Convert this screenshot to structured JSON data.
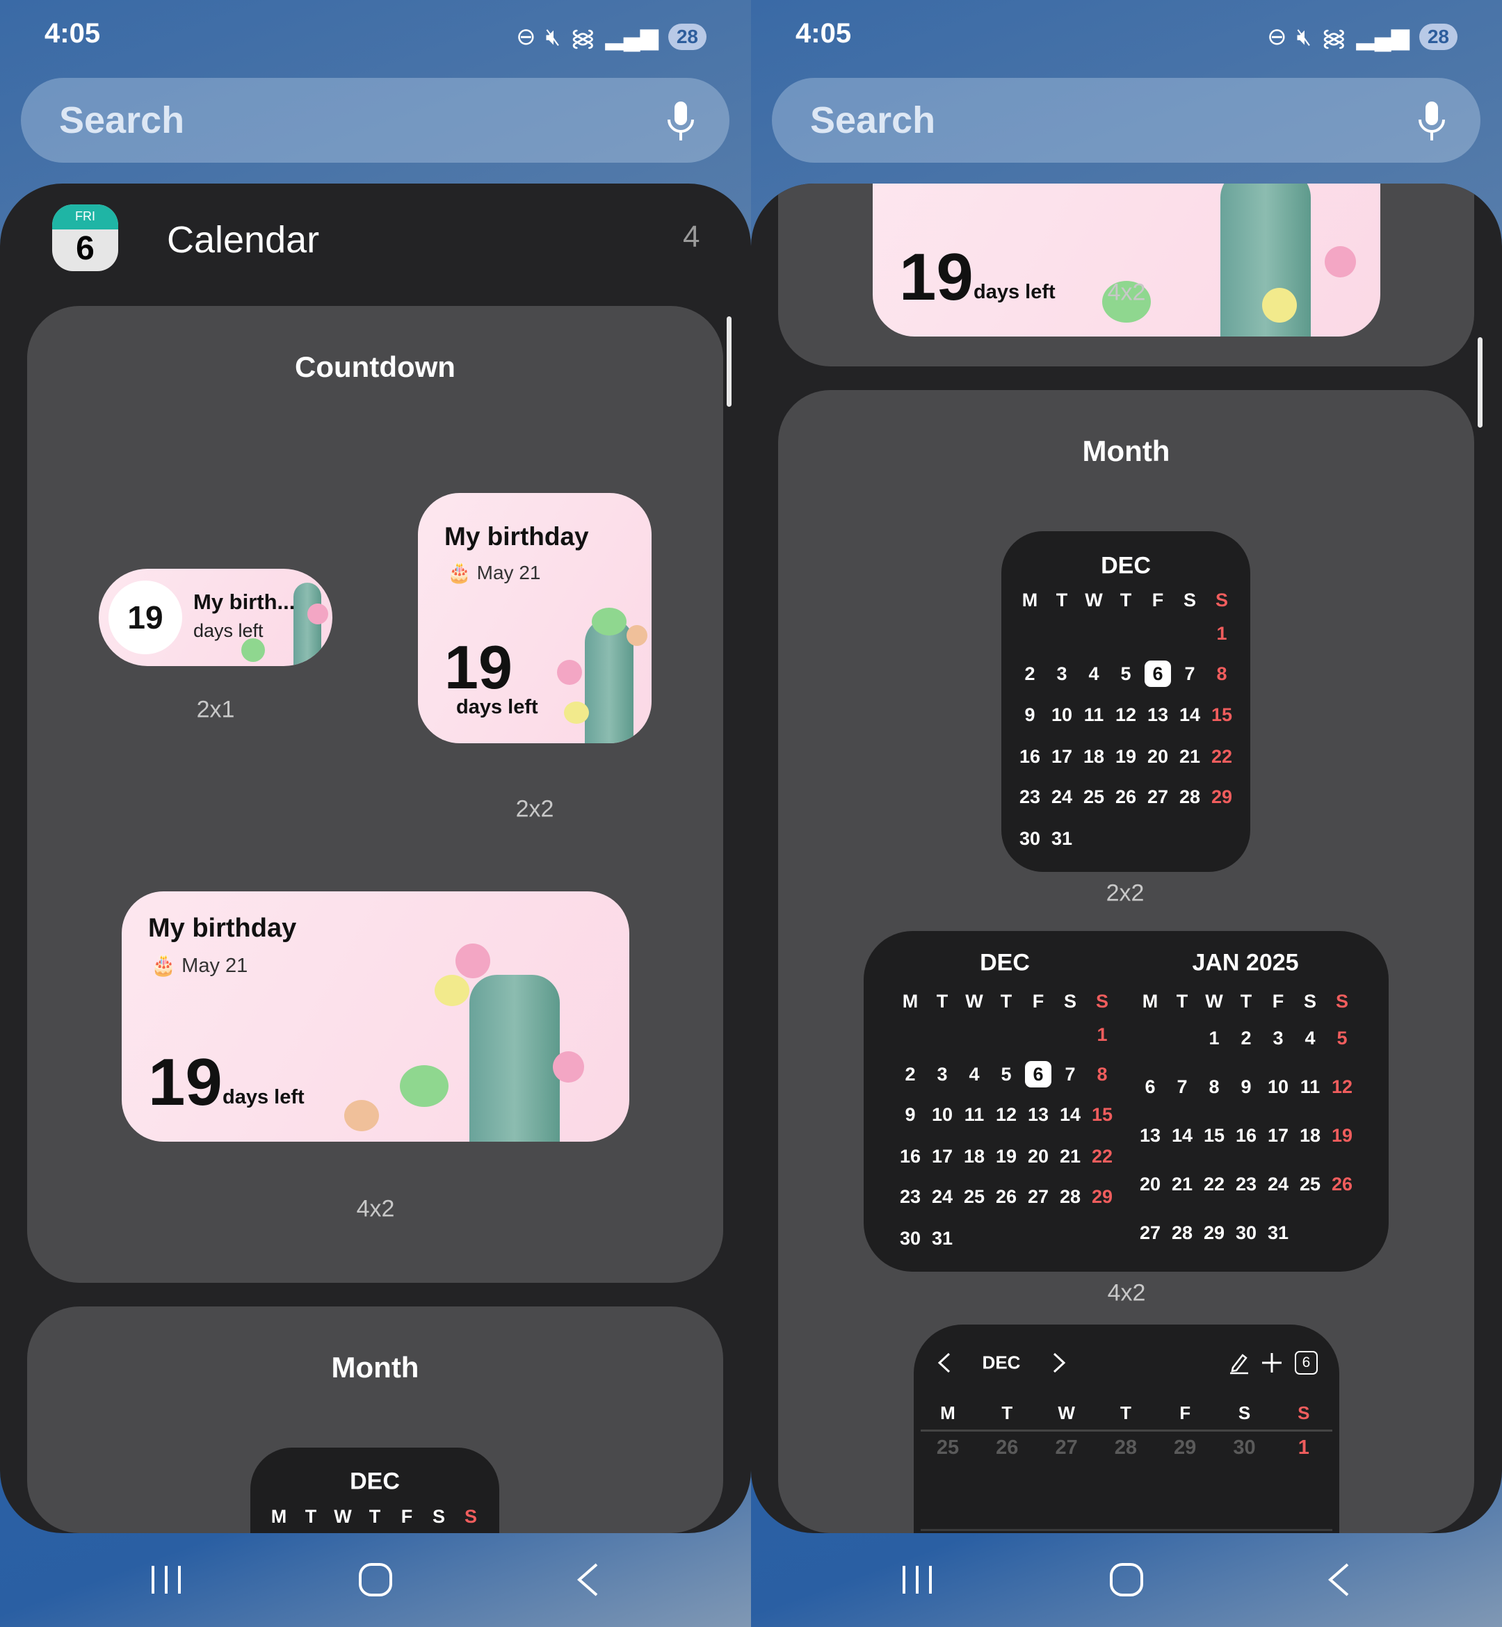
{
  "status_bar": {
    "time": "4:05",
    "battery": "28"
  },
  "search": {
    "placeholder": "Search"
  },
  "app": {
    "name": "Calendar",
    "icon_day": "FRI",
    "icon_date": "6",
    "widget_count": "4"
  },
  "countdown": {
    "title": "Countdown",
    "event": "My birthday",
    "event_short": "My birth...",
    "date": "May 21",
    "days": "19",
    "days_label": "days left",
    "size_2x1": "2x1",
    "size_2x2": "2x2",
    "size_4x2": "4x2"
  },
  "month": {
    "title": "Month",
    "weekdays": [
      "M",
      "T",
      "W",
      "T",
      "F",
      "S",
      "S"
    ],
    "today": "6",
    "dec": {
      "label": "DEC",
      "weeks": [
        [
          "",
          "",
          "",
          "",
          "",
          "",
          "1"
        ],
        [
          "2",
          "3",
          "4",
          "5",
          "6",
          "7",
          "8"
        ],
        [
          "9",
          "10",
          "11",
          "12",
          "13",
          "14",
          "15"
        ],
        [
          "16",
          "17",
          "18",
          "19",
          "20",
          "21",
          "22"
        ],
        [
          "23",
          "24",
          "25",
          "26",
          "27",
          "28",
          "29"
        ],
        [
          "30",
          "31",
          "",
          "",
          "",
          "",
          ""
        ]
      ]
    },
    "jan": {
      "label": "JAN 2025",
      "weeks": [
        [
          "",
          "",
          "1",
          "2",
          "3",
          "4",
          "5"
        ],
        [
          "6",
          "7",
          "8",
          "9",
          "10",
          "11",
          "12"
        ],
        [
          "13",
          "14",
          "15",
          "16",
          "17",
          "18",
          "19"
        ],
        [
          "20",
          "21",
          "22",
          "23",
          "24",
          "25",
          "26"
        ],
        [
          "27",
          "28",
          "29",
          "30",
          "31",
          "",
          ""
        ]
      ]
    },
    "size_2x2": "2x2",
    "size_4x2": "4x2",
    "week_widget": {
      "month": "DEC",
      "today_badge": "6",
      "dates": [
        "25",
        "26",
        "27",
        "28",
        "29",
        "30",
        "1"
      ]
    }
  },
  "colors": {
    "accent_red": "#f05d5d",
    "sheet": "#232325",
    "card": "#4a4a4c",
    "widget_dark": "#1e1e1f",
    "icon_teal": "#1fb5a5"
  }
}
